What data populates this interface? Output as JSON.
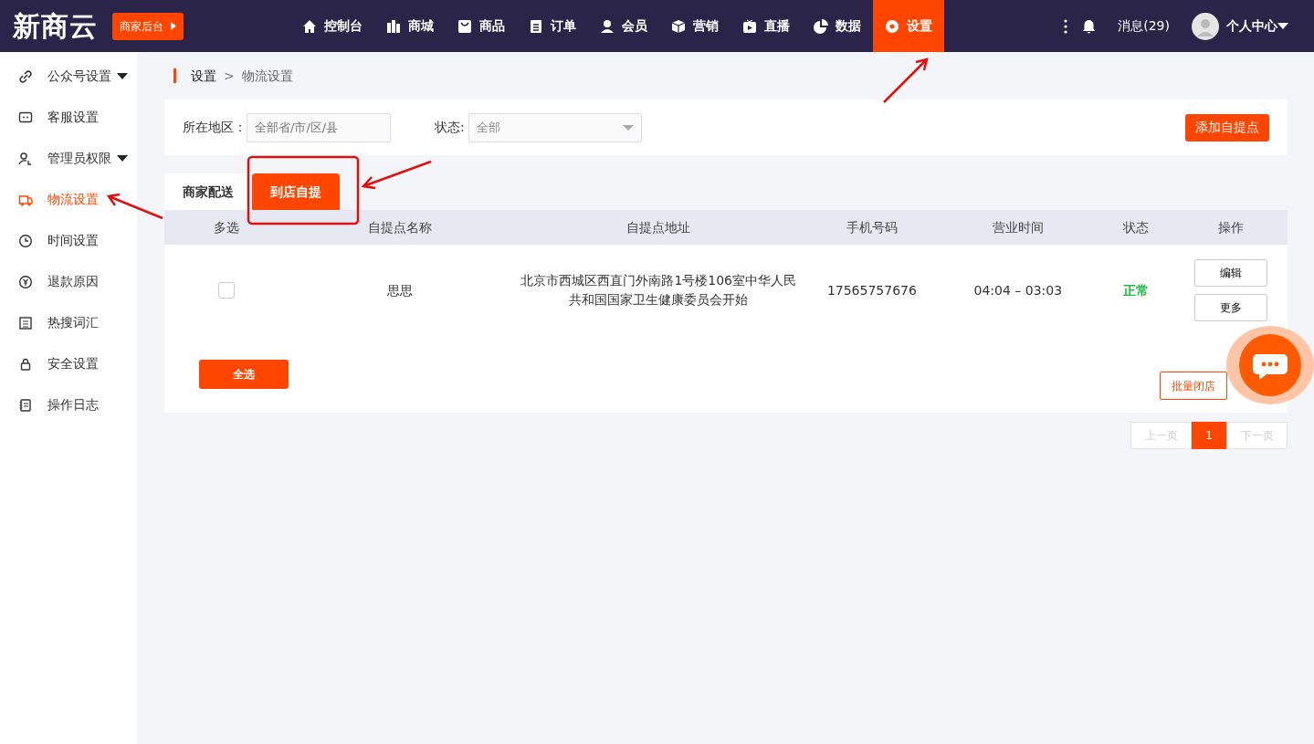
{
  "brand": {
    "logo": "新商云",
    "badge": "商家后台"
  },
  "nav": [
    {
      "label": "控制台",
      "selected": false
    },
    {
      "label": "商城",
      "selected": false
    },
    {
      "label": "商品",
      "selected": false
    },
    {
      "label": "订单",
      "selected": false
    },
    {
      "label": "会员",
      "selected": false
    },
    {
      "label": "营销",
      "selected": false
    },
    {
      "label": "直播",
      "selected": false
    },
    {
      "label": "数据",
      "selected": false
    },
    {
      "label": "设置",
      "selected": true
    }
  ],
  "header_right": {
    "messages": "消息(29)",
    "account": "个人中心"
  },
  "sidebar": {
    "items": [
      {
        "label": "公众号设置",
        "has_submenu": true,
        "selected": false
      },
      {
        "label": "客服设置",
        "has_submenu": false,
        "selected": false
      },
      {
        "label": "管理员权限",
        "has_submenu": true,
        "selected": false
      },
      {
        "label": "物流设置",
        "has_submenu": false,
        "selected": true
      },
      {
        "label": "时间设置",
        "has_submenu": false,
        "selected": false
      },
      {
        "label": "退款原因",
        "has_submenu": false,
        "selected": false
      },
      {
        "label": "热搜词汇",
        "has_submenu": false,
        "selected": false
      },
      {
        "label": "安全设置",
        "has_submenu": false,
        "selected": false
      },
      {
        "label": "操作日志",
        "has_submenu": false,
        "selected": false
      }
    ]
  },
  "breadcrumb": [
    "设置",
    "物流设置"
  ],
  "breadcrumb_separator": ">",
  "filters": {
    "region_label": "所在地区：",
    "region_placeholder": "全部省/市/区/县",
    "status_label": "状态:",
    "status_value": "全部",
    "add_button": "添加自提点"
  },
  "tabs": [
    {
      "label": "商家配送",
      "selected": false
    },
    {
      "label": "到店自提",
      "selected": true
    }
  ],
  "table": {
    "columns": [
      "多选",
      "自提点名称",
      "自提点地址",
      "手机号码",
      "营业时间",
      "状态",
      "操作"
    ],
    "rows": [
      {
        "checked": false,
        "name": "思思",
        "address": "北京市西城区西直门外南路1号楼106室中华人民共和国国家卫生健康委员会开始",
        "phone": "17565757676",
        "hours": "04:04 – 03:03",
        "status": "正常",
        "actions": [
          "编辑",
          "更多"
        ]
      }
    ]
  },
  "select_all": "全选",
  "bulk_close": "批量闭店",
  "pagination": {
    "prev": "上一页",
    "prev_disabled": true,
    "pages": [
      {
        "label": "1",
        "selected": true
      }
    ],
    "next": "下一页",
    "next_disabled": true
  }
}
